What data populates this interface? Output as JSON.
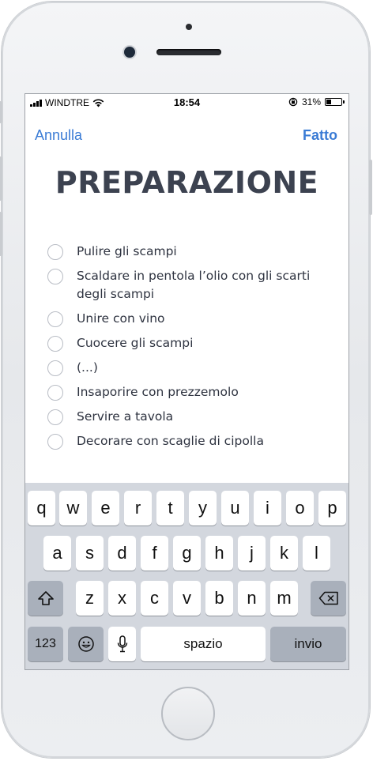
{
  "status_bar": {
    "carrier": "WINDTRE",
    "time": "18:54",
    "battery_percent": "31%",
    "battery_level": 0.31,
    "icons": [
      "signal-bars-icon",
      "wifi-icon",
      "orientation-lock-icon",
      "battery-icon"
    ]
  },
  "nav": {
    "cancel_label": "Annulla",
    "done_label": "Fatto"
  },
  "title": "PREPARAZIONE",
  "steps": [
    "Pulire gli scampi",
    "Scaldare in pentola l’olio con gli scarti degli scampi",
    "Unire con vino",
    "Cuocere gli scampi",
    "(...)",
    "Insaporire con prezzemolo",
    "Servire a tavola",
    "Decorare con scaglie di cipolla"
  ],
  "keyboard": {
    "row1": [
      "q",
      "w",
      "e",
      "r",
      "t",
      "y",
      "u",
      "i",
      "o",
      "p"
    ],
    "row2": [
      "a",
      "s",
      "d",
      "f",
      "g",
      "h",
      "j",
      "k",
      "l"
    ],
    "row3": [
      "z",
      "x",
      "c",
      "v",
      "b",
      "n",
      "m"
    ],
    "numbers_label": "123",
    "space_label": "spazio",
    "return_label": "invio"
  },
  "colors": {
    "accent": "#3a7bd5",
    "title": "#3c4250",
    "keyboard_bg": "#d3d7de",
    "dark_key": "#a9b0bb"
  }
}
